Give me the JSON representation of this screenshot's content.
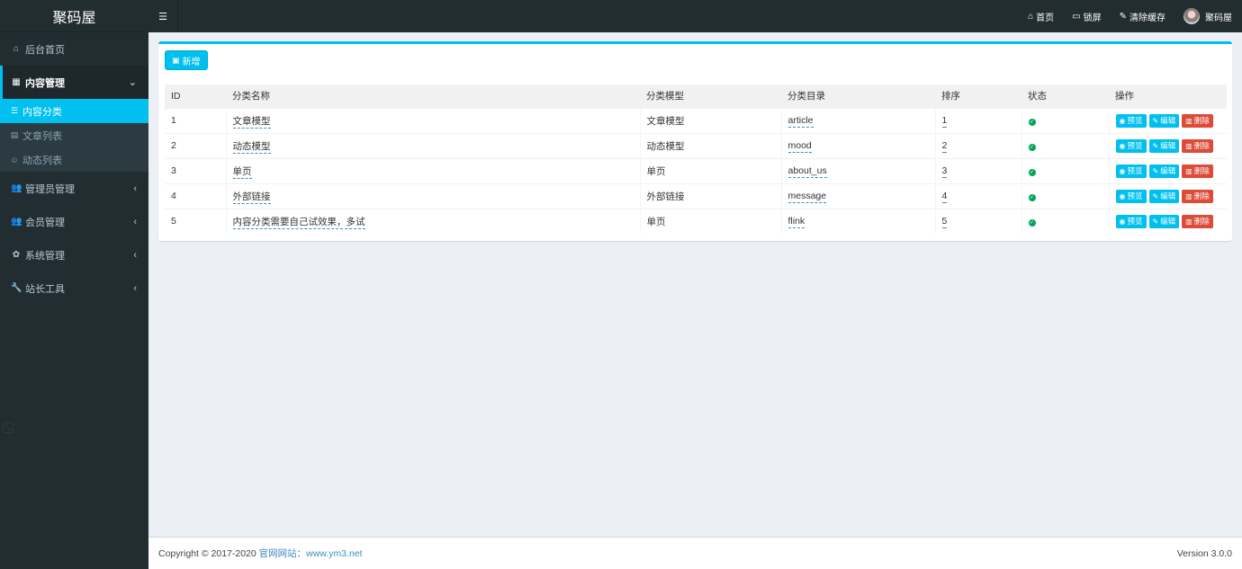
{
  "brand": "聚码屋",
  "sidebar": {
    "items": [
      {
        "label": "后台首页",
        "icon": "home-icon",
        "glyph": "⌂"
      },
      {
        "label": "内容管理",
        "icon": "grid-icon",
        "glyph": "▦",
        "arrow": "⌄"
      },
      {
        "label": "管理员管理",
        "icon": "users-icon",
        "glyph": "👥",
        "arrow": "‹"
      },
      {
        "label": "会员管理",
        "icon": "users-icon",
        "glyph": "👥",
        "arrow": "‹"
      },
      {
        "label": "系统管理",
        "icon": "gear-icon",
        "glyph": "✿",
        "arrow": "‹"
      },
      {
        "label": "站长工具",
        "icon": "wrench-icon",
        "glyph": "🔧",
        "arrow": "‹"
      }
    ],
    "submenu": [
      {
        "label": "内容分类",
        "icon": "list-icon",
        "glyph": "☰"
      },
      {
        "label": "文章列表",
        "icon": "file-icon",
        "glyph": "▤"
      },
      {
        "label": "动态列表",
        "icon": "smile-icon",
        "glyph": "☺"
      }
    ]
  },
  "navbar": {
    "toggle_glyph": "☰",
    "links": [
      {
        "label": "首页",
        "icon": "home-icon",
        "glyph": "⌂"
      },
      {
        "label": "锁屏",
        "icon": "monitor-icon",
        "glyph": "▭"
      },
      {
        "label": "清除缓存",
        "icon": "brush-icon",
        "glyph": "✎"
      }
    ],
    "user": "聚码屋"
  },
  "toolbar": {
    "add_label": "新增",
    "add_glyph": "▣"
  },
  "table": {
    "headers": [
      "ID",
      "分类名称",
      "分类模型",
      "分类目录",
      "排序",
      "状态",
      "操作"
    ],
    "rows": [
      {
        "id": "1",
        "name": "文章模型",
        "model": "文章模型",
        "dir": "article",
        "sort": "1"
      },
      {
        "id": "2",
        "name": "动态模型",
        "model": "动态模型",
        "dir": "mood",
        "sort": "2"
      },
      {
        "id": "3",
        "name": "单页",
        "model": "单页",
        "dir": "about_us",
        "sort": "3"
      },
      {
        "id": "4",
        "name": "外部链接",
        "model": "外部链接",
        "dir": "message",
        "sort": "4"
      },
      {
        "id": "5",
        "name": "内容分类需要自己试效果，多试",
        "model": "单页",
        "dir": "flink",
        "sort": "5"
      }
    ],
    "status_glyph": "✓",
    "ops": {
      "preview": "预览",
      "edit": "编辑",
      "delete": "删除",
      "preview_glyph": "◉",
      "edit_glyph": "✎",
      "delete_glyph": "▥"
    }
  },
  "footer": {
    "copyright": "Copyright © 2017-2020 ",
    "site_label": "官网网站：www.ym3.net",
    "version": "Version 3.0.0"
  },
  "colors": {
    "accent": "#00c0ef",
    "sidebar": "#222d32",
    "danger": "#dd4b39",
    "success": "#00a65a"
  }
}
